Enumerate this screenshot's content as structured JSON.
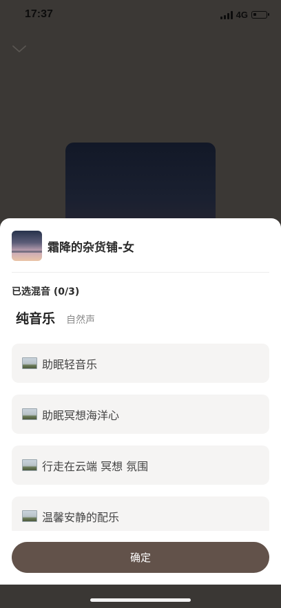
{
  "status_bar": {
    "time": "17:37",
    "network": "4G",
    "icons": [
      "signal-icon",
      "battery-icon"
    ]
  },
  "background": {
    "icons": [
      "chevron-down-icon"
    ]
  },
  "sheet": {
    "title": "霜降的杂货铺-女",
    "selected_label": "已选混音 (0/3)",
    "tabs": [
      {
        "label": "纯音乐",
        "active": true
      },
      {
        "label": "自然声",
        "active": false
      }
    ],
    "items": [
      {
        "label": "助眠轻音乐",
        "icon": "landscape-icon"
      },
      {
        "label": "助眠冥想海洋心",
        "icon": "landscape-icon"
      },
      {
        "label": "行走在云端 冥想 氛围",
        "icon": "landscape-icon"
      },
      {
        "label": "温馨安静的配乐",
        "icon": "landscape-icon"
      }
    ],
    "confirm_label": "确定"
  },
  "colors": {
    "accent_button": "#62524a",
    "overlay": "#3b3835",
    "item_background": "#f5f4f3"
  }
}
